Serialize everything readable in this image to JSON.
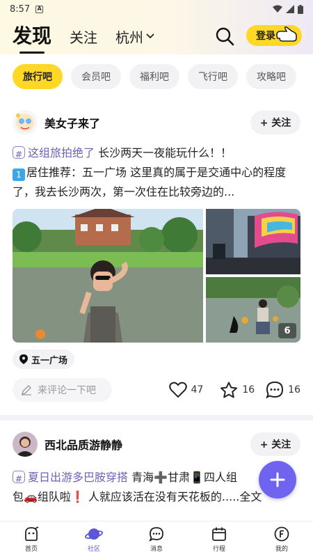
{
  "status_bar": {
    "time": "8:57",
    "notif": "A"
  },
  "top_nav": {
    "tabs": [
      "发现",
      "关注"
    ],
    "city": "杭州",
    "login_label": "登录"
  },
  "categories": [
    {
      "label": "旅行吧",
      "active": true
    },
    {
      "label": "会员吧",
      "active": false
    },
    {
      "label": "福利吧",
      "active": false
    },
    {
      "label": "飞行吧",
      "active": false
    },
    {
      "label": "攻略吧",
      "active": false
    }
  ],
  "posts": [
    {
      "author": "美女子来了",
      "follow_label": "+ 关注",
      "topic": "这组旅拍绝了",
      "title": "长沙两天一夜能玩什么！！",
      "num_badge": "1",
      "body": "居住推荐：五一广场 这里真的属于是交通中心的程度了，我去长沙两次，第一次住在比较旁边的...",
      "photo_count": "6",
      "location": "五一广场",
      "comment_placeholder": "来评论一下吧",
      "likes": "47",
      "favorites": "16",
      "comments": "16"
    },
    {
      "author": "西北品质游静静",
      "follow_label": "+ 关注",
      "topic": "夏日出游多巴胺穿搭",
      "body_line1": "青海➕甘肃📱四人组",
      "body_line2": "包🚗组队啦❗ 人就应该活在没有天花板的.....全文"
    }
  ],
  "bottom_nav": [
    {
      "label": "首页",
      "icon": "home-icon",
      "active": false
    },
    {
      "label": "社区",
      "icon": "planet-icon",
      "active": true
    },
    {
      "label": "消息",
      "icon": "message-icon",
      "active": false
    },
    {
      "label": "行程",
      "icon": "calendar-icon",
      "active": false
    },
    {
      "label": "我的",
      "icon": "profile-icon",
      "active": false
    }
  ],
  "colors": {
    "accent_yellow": "#ffd826",
    "accent_purple": "#6f63f0",
    "topic_purple": "#6b63b5"
  }
}
